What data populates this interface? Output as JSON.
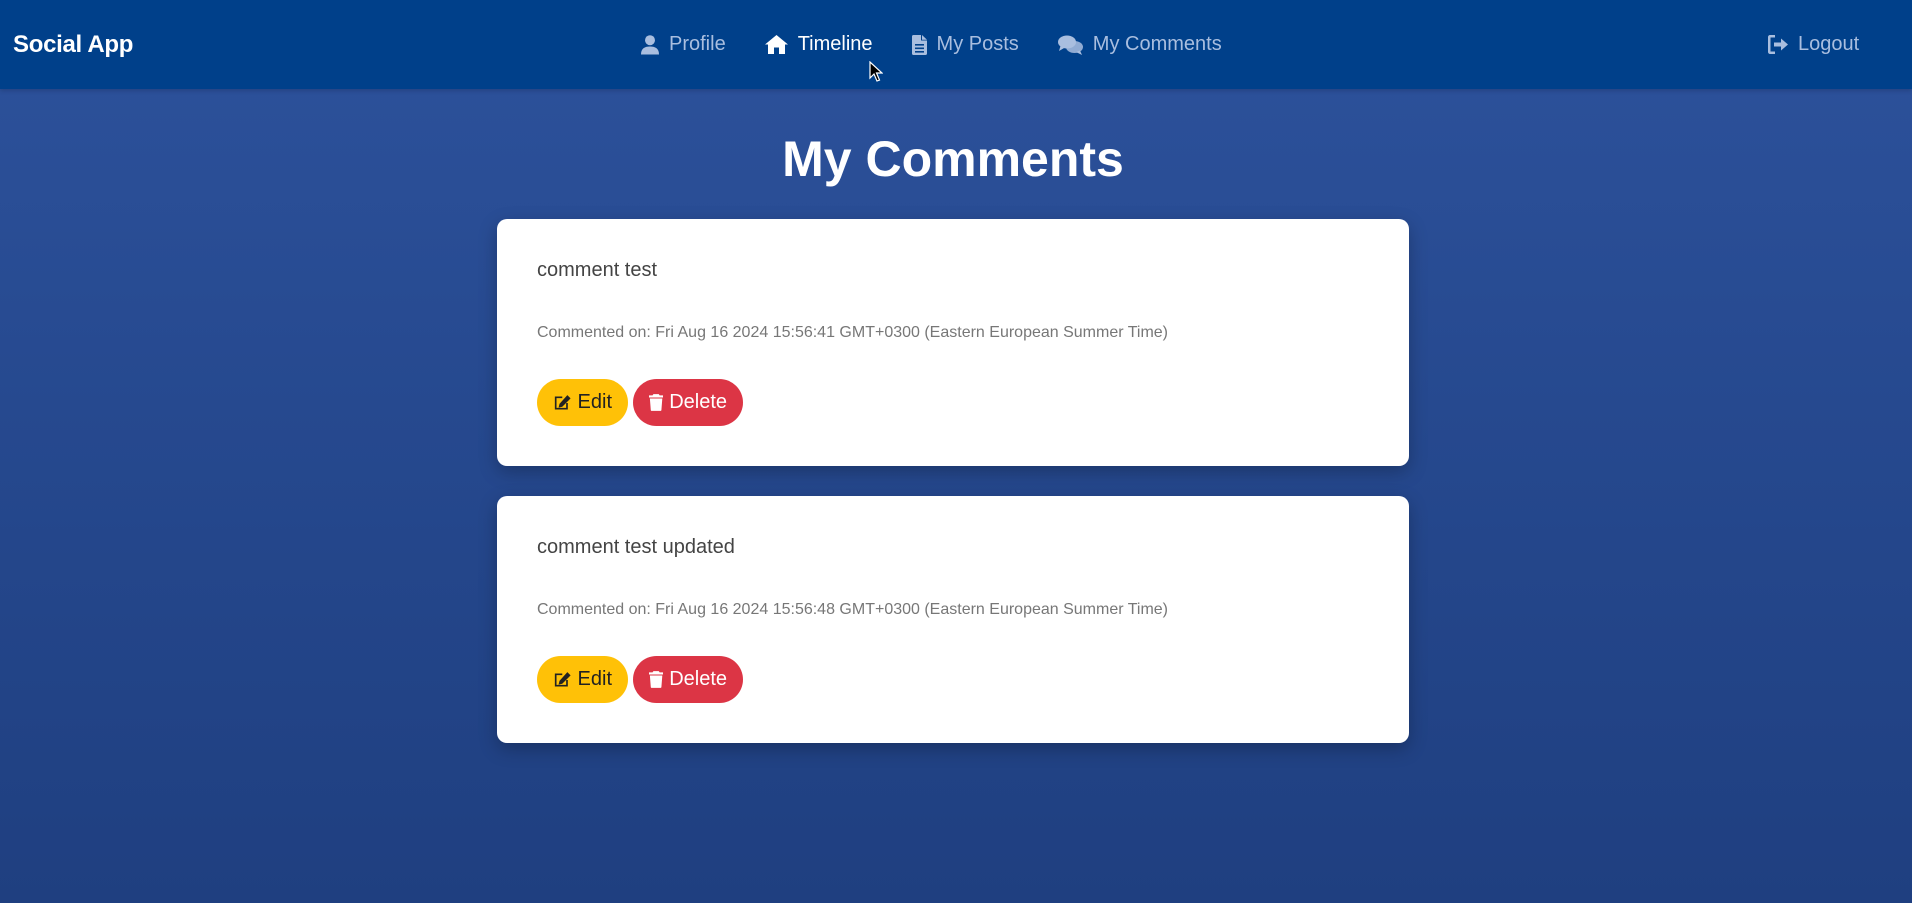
{
  "nav": {
    "brand": "Social App",
    "links": [
      {
        "label": "Profile",
        "icon": "user-icon",
        "active": false
      },
      {
        "label": "Timeline",
        "icon": "home-icon",
        "active": true
      },
      {
        "label": "My Posts",
        "icon": "file-icon",
        "active": false
      },
      {
        "label": "My Comments",
        "icon": "comments-icon",
        "active": false
      }
    ],
    "logout": {
      "label": "Logout",
      "icon": "logout-icon"
    }
  },
  "page": {
    "title": "My Comments"
  },
  "comments": [
    {
      "text": "comment test",
      "meta": "Commented on: Fri Aug 16 2024 15:56:41 GMT+0300 (Eastern European Summer Time)",
      "edit_label": "Edit",
      "delete_label": "Delete"
    },
    {
      "text": "comment test updated",
      "meta": "Commented on: Fri Aug 16 2024 15:56:48 GMT+0300 (Eastern European Summer Time)",
      "edit_label": "Edit",
      "delete_label": "Delete"
    }
  ],
  "colors": {
    "navbar": "#00408a",
    "background": "#2a4e96",
    "edit_button": "#ffc107",
    "delete_button": "#dc3545",
    "nav_inactive": "#a9bedf",
    "nav_active": "#ffffff"
  }
}
